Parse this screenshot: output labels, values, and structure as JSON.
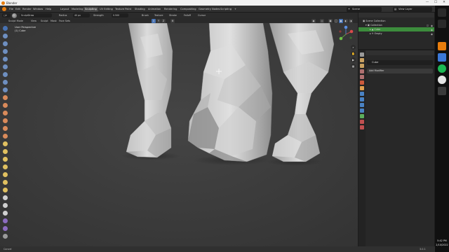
{
  "window": {
    "title": "Blender",
    "min": "—",
    "max": "☐",
    "close": "✕"
  },
  "menu": {
    "items": [
      "File",
      "Edit",
      "Render",
      "Window",
      "Help"
    ],
    "workspaces": [
      "Layout",
      "Modeling",
      "Sculpting",
      "UV Editing",
      "Texture Paint",
      "Shading",
      "Animation",
      "Rendering",
      "Compositing",
      "Geometry Nodes",
      "Scripting",
      "+"
    ],
    "active_workspace": "Sculpting",
    "scene": "Scene",
    "view_layer": "View Layer"
  },
  "tool_header": {
    "brush": "SculptDraw",
    "radius_label": "Radius",
    "radius": "40 px",
    "strength_label": "Strength",
    "strength": "0.500",
    "menus": [
      "Brush",
      "Texture",
      "Stroke",
      "Falloff",
      "Cursor"
    ]
  },
  "viewport_header": {
    "mode": "Sculpt Mode",
    "menus": [
      "View",
      "Sculpt",
      "Mask",
      "Face Sets"
    ],
    "xyz": [
      "X",
      "Y",
      "Z"
    ]
  },
  "viewport": {
    "perspective": "User Perspective",
    "object": "(1) Cube"
  },
  "outliner": {
    "root": "Scene Collection",
    "collection": "Collection",
    "objects": [
      "Cube",
      "Empty"
    ]
  },
  "properties": {
    "object_name": "Cube",
    "add_modifier": "Add Modifier"
  },
  "statusbar": {
    "left": "Cancel",
    "right": "3.0.1"
  },
  "taskbar": {
    "time": "5:42 PM",
    "date": "2/10/2022"
  },
  "colors": {
    "accent": "#e87d0d",
    "selection": "#4772b3",
    "active_row": "#3c8c3c",
    "mesh_light": "#d8d8d8",
    "mesh_dark": "#8e8e8e"
  }
}
